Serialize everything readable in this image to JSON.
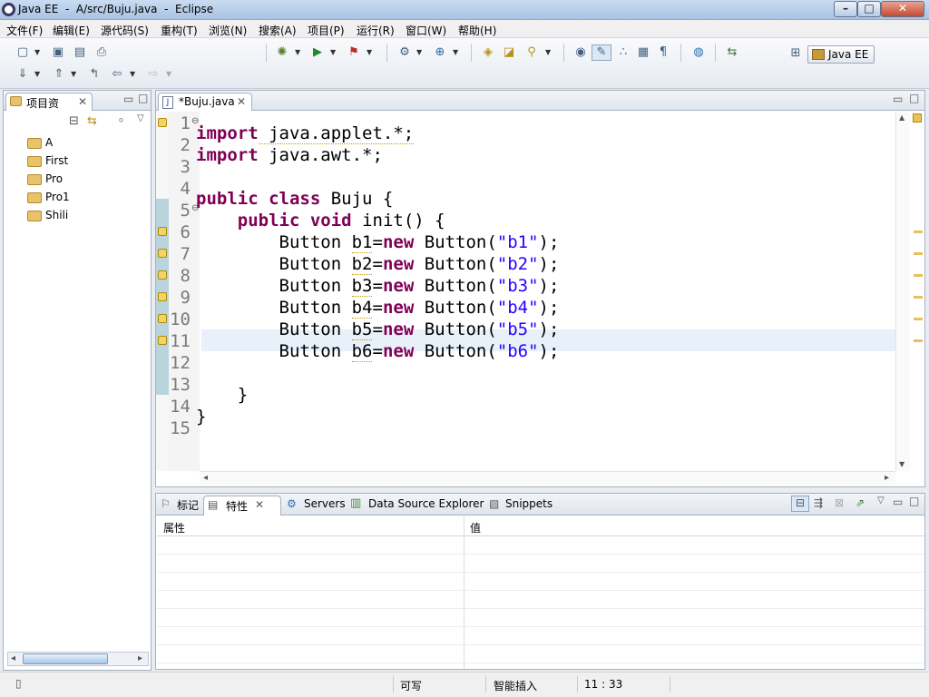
{
  "window": {
    "title": "Java EE  -  A/src/Buju.java  -  Eclipse"
  },
  "menu": [
    "文件(F)",
    "编辑(E)",
    "源代码(S)",
    "重构(T)",
    "浏览(N)",
    "搜索(A)",
    "项目(P)",
    "运行(R)",
    "窗口(W)",
    "帮助(H)"
  ],
  "perspective": {
    "label": "Java EE"
  },
  "project_explorer": {
    "tab_label": "项目资",
    "projects": [
      "A",
      "First",
      "Pro",
      "Pro1",
      "Shili"
    ]
  },
  "editor": {
    "tab_label": "*Buju.java",
    "line_numbers": [
      "1",
      "2",
      "3",
      "4",
      "5",
      "6",
      "7",
      "8",
      "9",
      "10",
      "11",
      "12",
      "13",
      "14",
      "15"
    ],
    "code": {
      "l1_kw": "import",
      "l1_rest": " java.applet.*;",
      "l2_kw": "import",
      "l2_rest": " java.awt.*;",
      "l4_kw1": "public",
      "l4_kw2": "class",
      "l4_rest": " Buju {",
      "l5_indent": "    ",
      "l5_kw1": "public",
      "l5_kw2": "void",
      "l5_rest": " init() {",
      "btn_prefix": "        Button ",
      "new_kw": "new",
      "lines": [
        {
          "var": "b1",
          "str": "\"b1\""
        },
        {
          "var": "b2",
          "str": "\"b2\""
        },
        {
          "var": "b3",
          "str": "\"b3\""
        },
        {
          "var": "b4",
          "str": "\"b4\""
        },
        {
          "var": "b5",
          "str": "\"b5\""
        },
        {
          "var": "b6",
          "str": "\"b6\""
        }
      ],
      "l13": "    }",
      "l14": "}"
    }
  },
  "bottom_panel": {
    "tabs": [
      "标记",
      "特性",
      "Servers",
      "Data Source Explorer",
      "Snippets"
    ],
    "columns": [
      "属性",
      "值"
    ]
  },
  "status": {
    "writable": "可写",
    "insert_mode": "智能插入",
    "position": "11 : 33"
  },
  "icons": [
    "eclipse-icon",
    "folder-icon",
    "warning-icon",
    "java-file-icon",
    "globe-icon"
  ]
}
